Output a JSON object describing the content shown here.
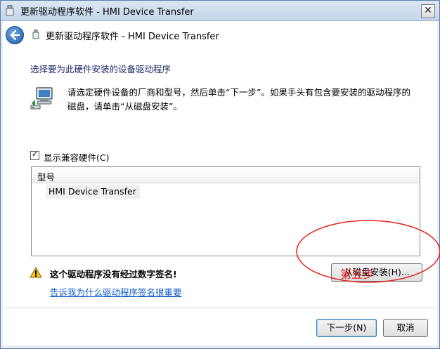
{
  "window": {
    "title": "更新驱动程序软件 - HMI Device Transfer",
    "close_glyph": "✕"
  },
  "nav": {
    "title": "更新驱动程序软件 - HMI Device Transfer"
  },
  "main": {
    "heading": "选择要为此硬件安装的设备驱动程序",
    "instructions": "请选定硬件设备的厂商和型号，然后单击“下一步”。如果手头有包含要安装的驱动程序的磁盘，请单击“从磁盘安装”。",
    "show_compatible": {
      "label": "显示兼容硬件(C)",
      "checked": true,
      "check_glyph": "✓"
    },
    "model_list": {
      "header": "型号",
      "items": [
        "HMI Device Transfer"
      ]
    },
    "warning": {
      "text": "这个驱动程序没有经过数字签名!",
      "link": "告诉我为什么驱动程序签名很重要"
    },
    "have_disk_label": "从磁盘安装(H)..."
  },
  "footer": {
    "next_label": "下一步(N)",
    "cancel_label": "取消"
  },
  "annotation": {
    "text": "第五步",
    "color": "#e0221e"
  },
  "icons": {
    "title": "usb-device-icon",
    "back": "back-arrow-icon",
    "hardware": "network-computer-icon",
    "warning": "warning-triangle-icon"
  }
}
